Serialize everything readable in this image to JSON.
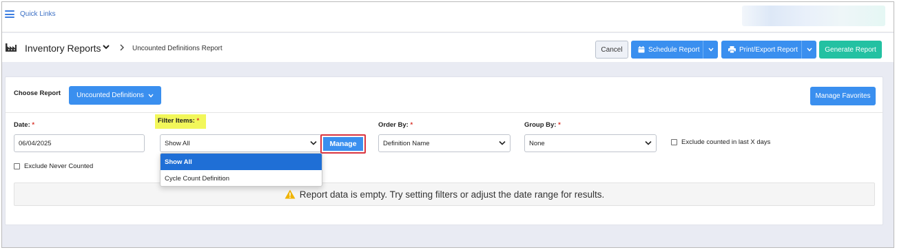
{
  "quick_links": {
    "label": "Quick Links"
  },
  "header": {
    "title": "Inventory Reports",
    "breadcrumb": "Uncounted Definitions Report",
    "cancel_label": "Cancel",
    "schedule_label": "Schedule Report",
    "print_label": "Print/Export Report",
    "generate_label": "Generate Report"
  },
  "report": {
    "choose_label": "Choose Report",
    "selected_report": "Uncounted Definitions",
    "manage_favorites_label": "Manage Favorites"
  },
  "filters": {
    "date": {
      "label": "Date:",
      "required_mark": "*",
      "value": "06/04/2025"
    },
    "filter_items": {
      "label": "Filter Items:",
      "required_mark": "*",
      "value": "Show All",
      "options": [
        "Show All",
        "Cycle Count Definition"
      ],
      "selected_index": 0
    },
    "manage_label": "Manage",
    "order_by": {
      "label": "Order By:",
      "required_mark": "*",
      "value": "Definition Name"
    },
    "group_by": {
      "label": "Group By:",
      "required_mark": "*",
      "value": "None"
    },
    "exclude_counted_label": "Exclude counted in last X days",
    "exclude_never_label": "Exclude Never Counted"
  },
  "empty_message": "Report data is empty. Try setting filters or adjust the date range for results.",
  "colors": {
    "primary": "#3a8fef",
    "generate": "#23c1a2",
    "highlight": "#f2f75a",
    "manage_outline": "#d9333f",
    "warning": "#f0b400"
  }
}
